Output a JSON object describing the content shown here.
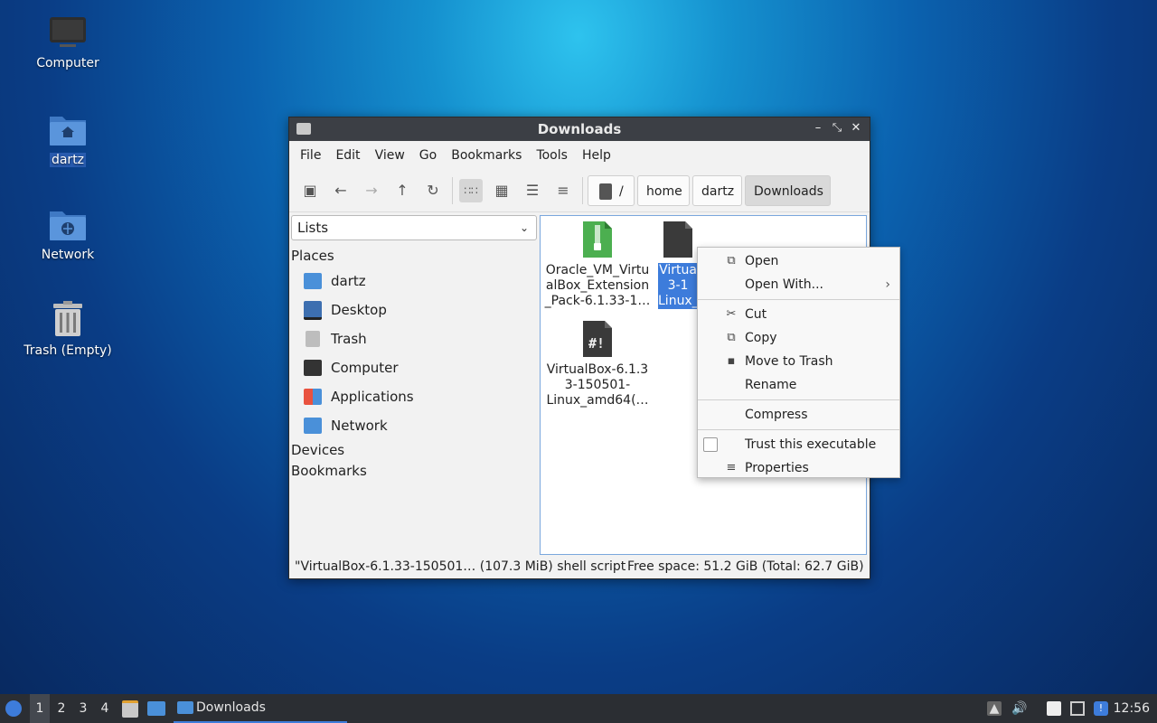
{
  "desktop": {
    "icons": [
      {
        "label": "Computer"
      },
      {
        "label": "dartz"
      },
      {
        "label": "Network"
      },
      {
        "label": "Trash (Empty)"
      }
    ]
  },
  "window": {
    "title": "Downloads",
    "menu": [
      "File",
      "Edit",
      "View",
      "Go",
      "Bookmarks",
      "Tools",
      "Help"
    ],
    "breadcrumb": [
      "/",
      "home",
      "dartz",
      "Downloads"
    ],
    "sidebar": {
      "select_value": "Lists",
      "places_header": "Places",
      "places": [
        {
          "label": "dartz",
          "icon": "home-folder-icon"
        },
        {
          "label": "Desktop",
          "icon": "desktop-icon"
        },
        {
          "label": "Trash",
          "icon": "trash-icon"
        },
        {
          "label": "Computer",
          "icon": "computer-icon"
        },
        {
          "label": "Applications",
          "icon": "applications-icon"
        },
        {
          "label": "Network",
          "icon": "network-folder-icon"
        }
      ],
      "devices_header": "Devices",
      "bookmarks_header": "Bookmarks"
    },
    "files": [
      {
        "name": "Oracle_VM_Virtu alBox_Extension _Pack-6.1.33-1…",
        "lines": [
          "Oracle_VM_Virtu",
          "alBox_Extension",
          "_Pack-6.1.33-1…"
        ],
        "icon": "archive-icon"
      },
      {
        "name": "Virtua… 3-1… Linux_",
        "lines": [
          "Virtua",
          "3-1",
          "Linux_"
        ],
        "icon": "script-icon",
        "selected": true
      },
      {
        "name": "VirtualBox-6.1.3 3-150501- Linux_amd64(…",
        "lines": [
          "VirtualBox-6.1.3",
          "3-150501-",
          "Linux_amd64(…"
        ],
        "icon": "script-icon"
      }
    ],
    "status": {
      "selection": "\"VirtualBox-6.1.33-150501… (107.3 MiB) shell script",
      "free_space": "Free space: 51.2 GiB (Total: 62.7 GiB)"
    }
  },
  "context_menu": {
    "items": [
      {
        "label": "Open",
        "icon": "open-icon"
      },
      {
        "label": "Open With...",
        "submenu": true
      },
      {
        "label": "Cut",
        "icon": "scissors-icon"
      },
      {
        "label": "Copy",
        "icon": "copy-icon"
      },
      {
        "label": "Move to Trash",
        "icon": "trash-icon"
      },
      {
        "label": "Rename"
      },
      {
        "label": "Compress"
      },
      {
        "label": "Trust this executable",
        "checkbox": true,
        "checked": false
      },
      {
        "label": "Properties",
        "icon": "properties-icon"
      }
    ]
  },
  "taskbar": {
    "workspaces": [
      "1",
      "2",
      "3",
      "4"
    ],
    "current_workspace": "1",
    "task_label": "Downloads",
    "clock": "12:56"
  },
  "colors": {
    "accent": "#3d7cdb",
    "titlebar": "#3c3f45",
    "taskbar": "#2b2e33"
  }
}
